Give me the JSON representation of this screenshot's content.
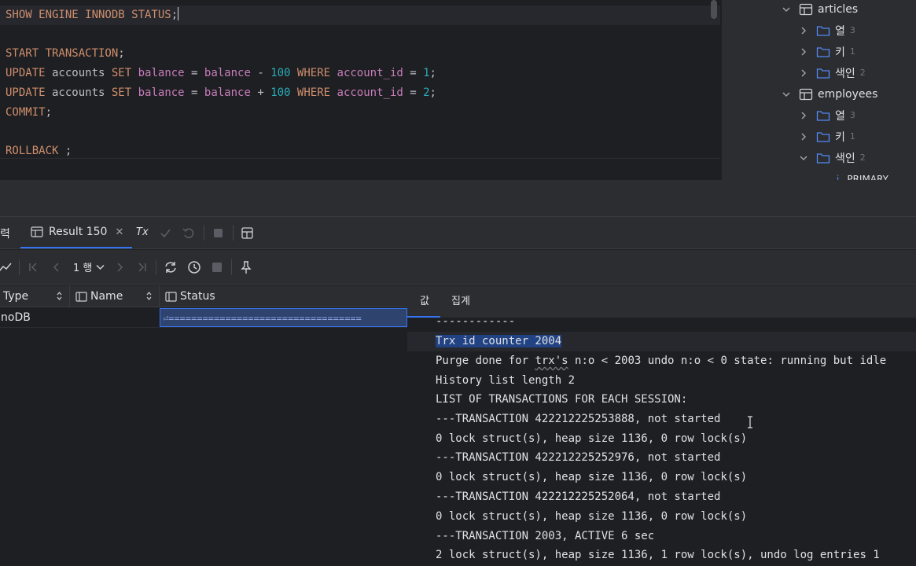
{
  "editor": {
    "line1": {
      "k1": "SHOW ENGINE INNODB STATUS",
      "p": ";"
    },
    "line3": {
      "k": "START TRANSACTION",
      "p": ";"
    },
    "line4": {
      "k1": "UPDATE",
      "t1": " accounts ",
      "k2": "SET",
      "c1": " balance ",
      "t2": "= ",
      "c2": "balance",
      "t3": " - ",
      "n1": "100",
      "k3": " WHERE ",
      "c3": "account_id",
      "t4": " = ",
      "n2": "1",
      "p": ";"
    },
    "line5": {
      "k1": "UPDATE",
      "t1": " accounts ",
      "k2": "SET",
      "c1": " balance ",
      "t2": "= ",
      "c2": "balance",
      "t3": " + ",
      "n1": "100",
      "k3": " WHERE ",
      "c3": "account_id",
      "t4": " = ",
      "n2": "2",
      "p": ";"
    },
    "line6": {
      "k": "COMMIT",
      "p": ";"
    },
    "line8": {
      "k": "ROLLBACK",
      "p": " ;"
    }
  },
  "tree": {
    "articles": {
      "label": "articles",
      "children": [
        {
          "label": "열",
          "count": "3"
        },
        {
          "label": "키",
          "count": "1"
        },
        {
          "label": "색인",
          "count": "2"
        }
      ]
    },
    "employees": {
      "label": "employees",
      "children": [
        {
          "label": "열",
          "count": "3"
        },
        {
          "label": "키",
          "count": "1"
        },
        {
          "label": "색인",
          "count": "2"
        }
      ]
    },
    "cut_item": "PRIMARY"
  },
  "results": {
    "tab_cut": "력",
    "tab_label": "Result 150",
    "tx_label": "Tx",
    "page_label": "1 행",
    "columns": [
      "Type",
      "Name",
      "Status"
    ],
    "row": {
      "type": "noDB",
      "name": "",
      "status": "⏎=================================="
    }
  },
  "value_panel": {
    "tabs": [
      "값",
      "집계"
    ],
    "lines": [
      "------------",
      "Trx id counter 2004",
      "Purge done for ",
      "trx's",
      " n:o < 2003 undo n:o < 0 state: running but idle",
      "History list length 2",
      "LIST OF TRANSACTIONS FOR EACH SESSION:",
      "---TRANSACTION 422212225253888, not started",
      "0 lock struct(s), heap size 1136, 0 row lock(s)",
      "---TRANSACTION 422212225252976, not started",
      "0 lock struct(s), heap size 1136, 0 row lock(s)",
      "---TRANSACTION 422212225252064, not started",
      "0 lock struct(s), heap size 1136, 0 row lock(s)",
      "---TRANSACTION 2003, ACTIVE 6 sec",
      "2 lock struct(s), heap size 1136, 1 row lock(s), undo log entries 1"
    ]
  }
}
